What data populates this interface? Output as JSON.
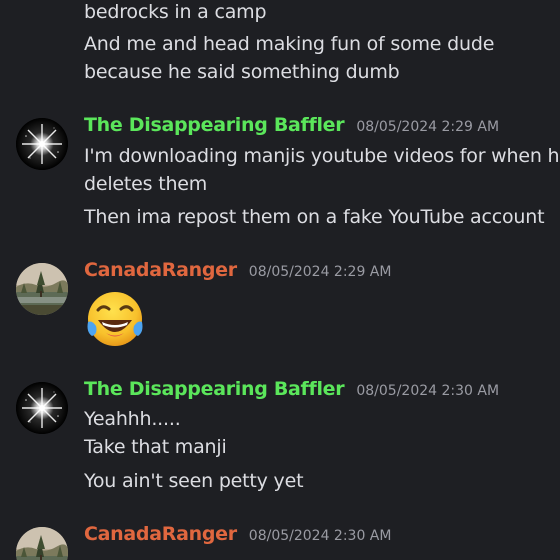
{
  "colors": {
    "background": "#1e1f23",
    "text": "#dcdde2",
    "timestamp": "#9a9ba3",
    "author_baffler": "#5be65b",
    "author_canada": "#e0673f"
  },
  "messages": [
    {
      "continuation": true,
      "lines": [
        "bedrocks in a camp"
      ]
    },
    {
      "continuation": true,
      "lines": [
        "And me and head making fun of some dude",
        "because he said something dumb"
      ]
    },
    {
      "author": "The Disappearing Baffler",
      "avatar_icon": "starburst-avatar-icon",
      "timestamp": "08/05/2024 2:29 AM",
      "lines": [
        "I'm downloading manjis youtube videos for when he",
        "deletes them"
      ]
    },
    {
      "continuation": true,
      "lines": [
        "Then ima repost them on a fake YouTube account"
      ]
    },
    {
      "author": "CanadaRanger",
      "avatar_icon": "landscape-avatar-icon",
      "timestamp": "08/05/2024 2:29 AM",
      "emoji": "face-with-tears-of-joy-emoji"
    },
    {
      "author": "The Disappearing Baffler",
      "avatar_icon": "starburst-avatar-icon",
      "timestamp": "08/05/2024 2:30 AM",
      "lines": [
        "Yeahhh.....",
        "Take that manji"
      ]
    },
    {
      "continuation": true,
      "lines": [
        "You ain't seen petty yet"
      ]
    },
    {
      "author": "CanadaRanger",
      "avatar_icon": "landscape-avatar-icon",
      "timestamp": "08/05/2024 2:30 AM"
    }
  ]
}
